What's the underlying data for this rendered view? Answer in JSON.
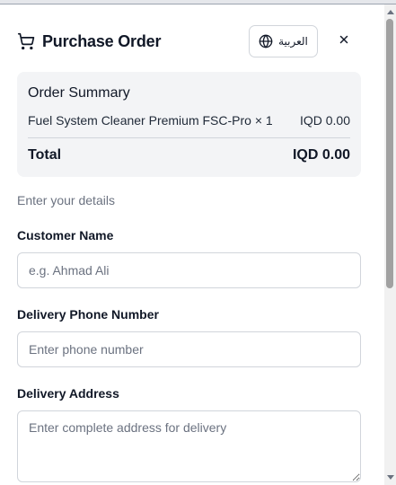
{
  "header": {
    "title": "Purchase Order",
    "language_button": "العربية"
  },
  "icons": {
    "cart": "shopping-cart-icon",
    "globe": "globe-icon",
    "close": "close-icon"
  },
  "order_summary": {
    "title": "Order Summary",
    "item": {
      "label": "Fuel System Cleaner Premium FSC-Pro × 1",
      "price": "IQD 0.00"
    },
    "total_label": "Total",
    "total_value": "IQD 0.00"
  },
  "form": {
    "subtitle": "Enter your details",
    "name": {
      "label": "Customer Name",
      "placeholder": "e.g. Ahmad Ali",
      "value": ""
    },
    "phone": {
      "label": "Delivery Phone Number",
      "placeholder": "Enter phone number",
      "value": ""
    },
    "address": {
      "label": "Delivery Address",
      "placeholder": "Enter complete address for delivery",
      "value": ""
    }
  },
  "colors": {
    "summary_background": "#f3f4f6",
    "border": "#d1d5db",
    "muted_text": "#6b7280"
  }
}
